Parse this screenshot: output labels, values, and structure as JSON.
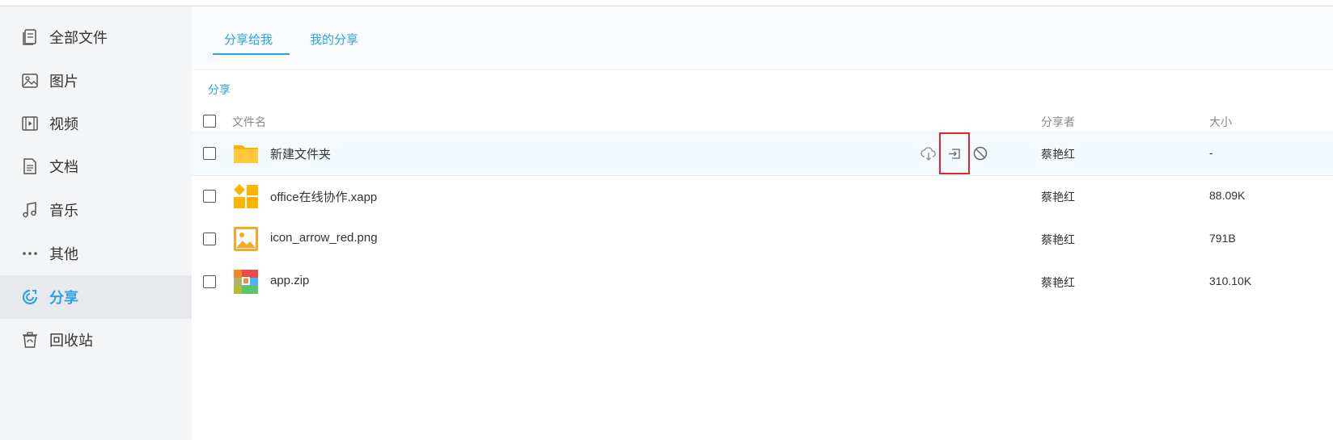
{
  "sidebar": {
    "items": [
      {
        "label": "全部文件",
        "icon": "all-files-icon"
      },
      {
        "label": "图片",
        "icon": "image-icon"
      },
      {
        "label": "视频",
        "icon": "video-icon"
      },
      {
        "label": "文档",
        "icon": "document-icon"
      },
      {
        "label": "音乐",
        "icon": "music-icon"
      },
      {
        "label": "其他",
        "icon": "more-icon"
      },
      {
        "label": "分享",
        "icon": "share-icon"
      },
      {
        "label": "回收站",
        "icon": "recycle-bin-icon"
      }
    ],
    "active_index": 6
  },
  "tabs": [
    {
      "label": "分享给我",
      "active": true
    },
    {
      "label": "我的分享",
      "active": false
    }
  ],
  "breadcrumb": "分享",
  "table": {
    "headers": {
      "name": "文件名",
      "sharer": "分享者",
      "size": "大小"
    },
    "rows": [
      {
        "name": "新建文件夹",
        "sharer": "蔡艳红",
        "size": "-",
        "type": "folder"
      },
      {
        "name": "office在线协作.xapp",
        "sharer": "蔡艳红",
        "size": "88.09K",
        "type": "xapp"
      },
      {
        "name": "icon_arrow_red.png",
        "sharer": "蔡艳红",
        "size": "791B",
        "type": "image"
      },
      {
        "name": "app.zip",
        "sharer": "蔡艳红",
        "size": "310.10K",
        "type": "zip"
      }
    ]
  },
  "row_actions": [
    "cloud-download-icon",
    "save-to-icon",
    "cancel-icon"
  ],
  "colors": {
    "accent": "#2ba2e6",
    "highlight": "#e0262b",
    "folder": "#ffc52b"
  }
}
